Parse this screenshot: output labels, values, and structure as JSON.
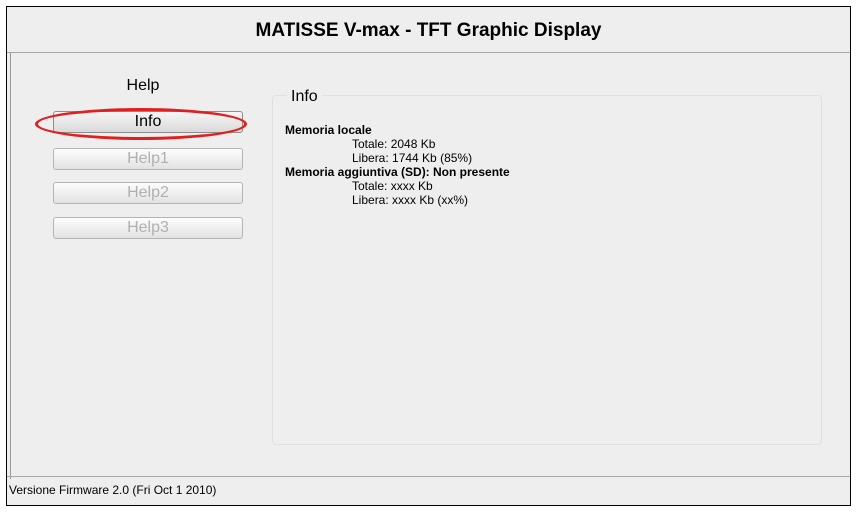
{
  "header": {
    "title": "MATISSE V-max - TFT Graphic Display"
  },
  "sidebar": {
    "heading": "Help",
    "items": [
      {
        "label": "Info",
        "state": "active"
      },
      {
        "label": "Help1",
        "state": "disabled"
      },
      {
        "label": "Help2",
        "state": "disabled"
      },
      {
        "label": "Help3",
        "state": "disabled"
      }
    ]
  },
  "info": {
    "title": "Info",
    "sections": [
      {
        "label": "Memoria locale",
        "rows": [
          "Totale: 2048 Kb",
          "Libera: 1744 Kb (85%)"
        ]
      },
      {
        "label": "Memoria aggiuntiva (SD): Non presente",
        "rows": [
          "Totale: xxxx Kb",
          "Libera: xxxx Kb (xx%)"
        ]
      }
    ]
  },
  "footer": {
    "version": "Versione Firmware 2.0 (Fri Oct 1 2010)"
  },
  "colors": {
    "highlight": "#e02020",
    "background": "#eeeeee",
    "disabled_text": "#b0b0b0"
  },
  "icons": []
}
